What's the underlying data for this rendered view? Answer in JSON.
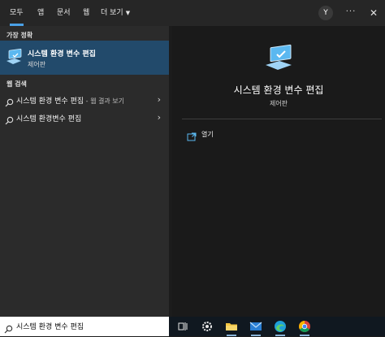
{
  "header": {
    "tabs": [
      {
        "label": "모두",
        "active": true
      },
      {
        "label": "앱"
      },
      {
        "label": "문서"
      },
      {
        "label": "웹"
      },
      {
        "label": "더 보기"
      }
    ],
    "avatar_initial": "Y",
    "more_label": "···",
    "close_label": "✕"
  },
  "left": {
    "best_match_header": "가장 정확",
    "best_match": {
      "title": "시스템 환경 변수 편집",
      "subtitle": "제어판",
      "icon": "monitor-check-icon"
    },
    "web_header": "웹 검색",
    "web_results": [
      {
        "text": "시스템 환경 변수 편집",
        "suffix": " - 웹 결과 보기"
      },
      {
        "text": "시스템 환경변수 편집",
        "suffix": ""
      }
    ]
  },
  "detail": {
    "title": "시스템 환경 변수 편집",
    "subtitle": "제어판",
    "actions": [
      {
        "label": "열기",
        "icon": "open-window-icon"
      }
    ]
  },
  "search": {
    "value": "시스템 환경 변수 편집",
    "icon": "search-icon"
  },
  "taskbar": {
    "icons": [
      "task-view-icon",
      "settings-icon",
      "file-explorer-icon",
      "mail-icon",
      "edge-icon",
      "chrome-icon"
    ]
  },
  "colors": {
    "accent": "#4aa0e6",
    "selection": "#224a6b",
    "panel": "#2b2b2b",
    "detail_bg": "#1a1a1a"
  }
}
